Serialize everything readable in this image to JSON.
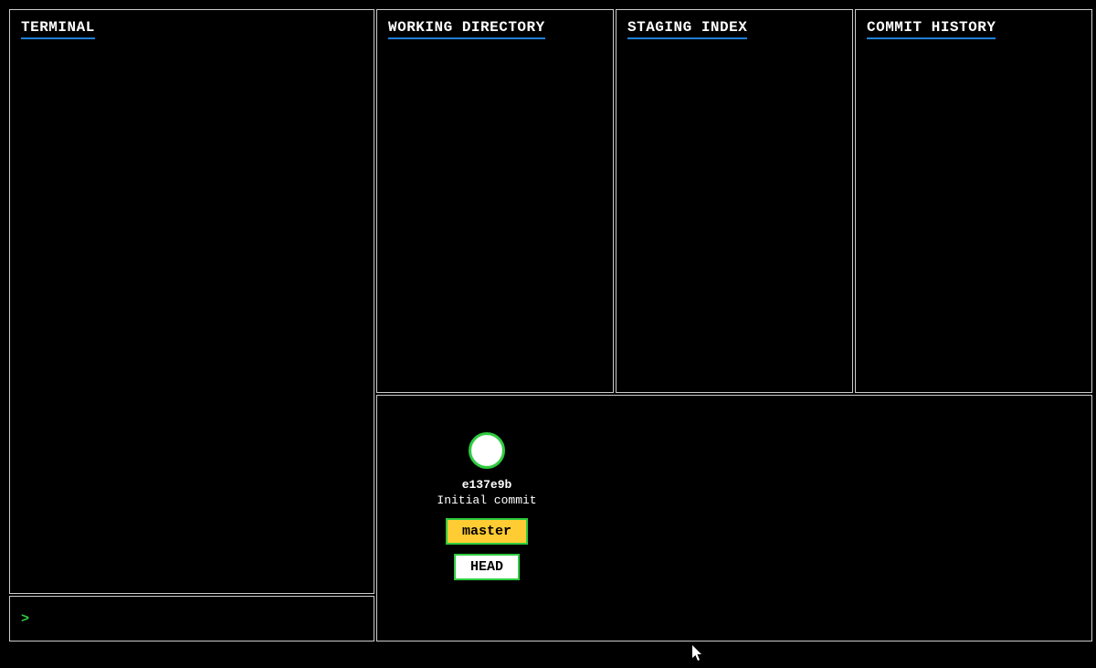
{
  "panels": {
    "terminal": {
      "title": "TERMINAL"
    },
    "working_dir": {
      "title": "WORKING DIRECTORY"
    },
    "staging": {
      "title": "STAGING INDEX"
    },
    "history": {
      "title": "COMMIT HISTORY"
    }
  },
  "prompt": {
    "symbol": ">",
    "value": ""
  },
  "graph": {
    "commits": [
      {
        "hash": "e137e9b",
        "message": "Initial commit",
        "branch": "master",
        "head": "HEAD"
      }
    ]
  },
  "colors": {
    "accent": "#1e7fd6",
    "green": "#2ecc40",
    "yellow": "#ffcc33",
    "border": "#cccccc"
  }
}
